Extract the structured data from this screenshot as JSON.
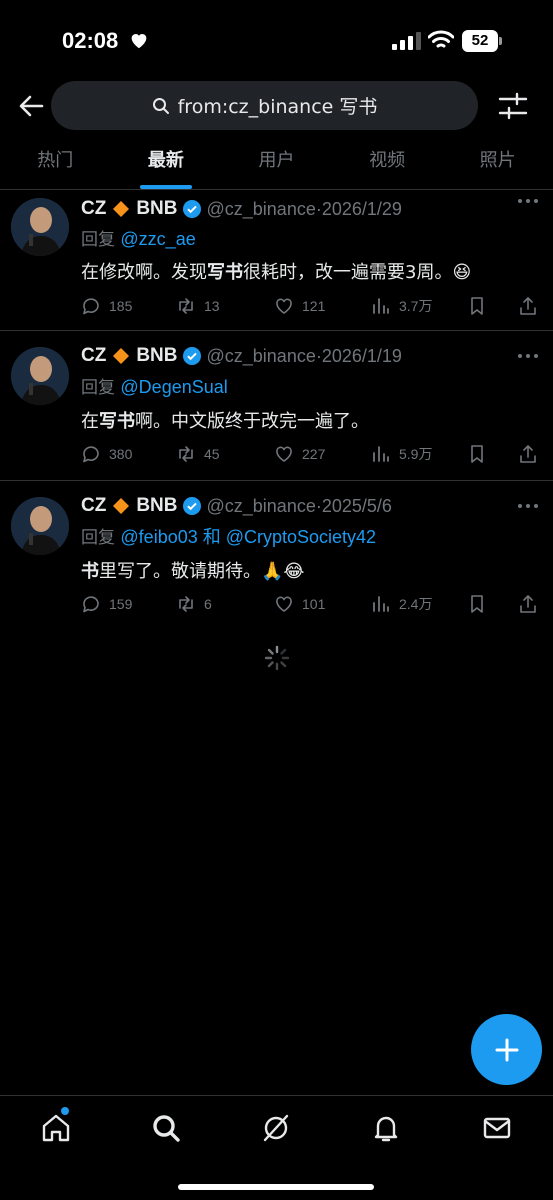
{
  "status_bar": {
    "time": "02:08",
    "battery": "52"
  },
  "header": {
    "search_query": "from:cz_binance 写书"
  },
  "tabs": [
    {
      "label": "热门",
      "active": false
    },
    {
      "label": "最新",
      "active": true
    },
    {
      "label": "用户",
      "active": false
    },
    {
      "label": "视频",
      "active": false
    },
    {
      "label": "照片",
      "active": false
    }
  ],
  "tweets": [
    {
      "name": "CZ",
      "name_suffix": "BNB",
      "handle": "@cz_binance",
      "date": "·2026/1/29",
      "reply_prefix": "回复",
      "reply_to": "@zzc_ae",
      "text_a": "在修改啊。发现",
      "text_bold": "写书",
      "text_b": "很耗时，改一遍需要3周。😆",
      "replies": "185",
      "reposts": "13",
      "likes": "121",
      "views": "3.7万"
    },
    {
      "name": "CZ",
      "name_suffix": "BNB",
      "handle": "@cz_binance",
      "date": "·2026/1/19",
      "reply_prefix": "回复",
      "reply_to": "@DegenSual",
      "text_a": "在",
      "text_bold": "写书",
      "text_b": "啊。中文版终于改完一遍了。",
      "replies": "380",
      "reposts": "45",
      "likes": "227",
      "views": "5.9万"
    },
    {
      "name": "CZ",
      "name_suffix": "BNB",
      "handle": "@cz_binance",
      "date": "·2025/5/6",
      "reply_prefix": "回复",
      "reply_to": "@feibo03 和 @CryptoSociety42",
      "text_a": "",
      "text_bold": "书",
      "text_b": "里写了。敬请期待。🙏😂",
      "replies": "159",
      "reposts": "6",
      "likes": "101",
      "views": "2.4万"
    }
  ],
  "colors": {
    "accent": "#1d9bf0",
    "muted": "#71767b",
    "background": "#000000",
    "diamond": "#f7931a"
  },
  "icons": [
    "back-arrow-icon",
    "search-icon",
    "filter-icon",
    "verified-icon",
    "reply-icon",
    "repost-icon",
    "like-icon",
    "views-icon",
    "bookmark-icon",
    "share-icon",
    "home-icon",
    "explore-icon",
    "grok-icon",
    "notifications-icon",
    "messages-icon",
    "compose-icon"
  ]
}
